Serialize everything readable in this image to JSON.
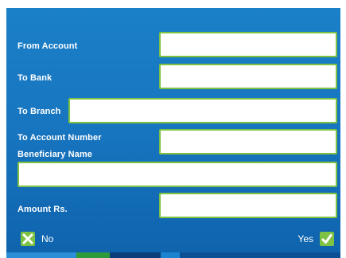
{
  "form": {
    "from_account": {
      "label": "From Account",
      "value": ""
    },
    "to_bank": {
      "label": "To Bank",
      "value": ""
    },
    "to_branch": {
      "label": "To Branch",
      "value": ""
    },
    "to_account_number": {
      "label": "To Account Number",
      "value": ""
    },
    "beneficiary_name": {
      "label": "Beneficiary Name",
      "value": ""
    },
    "amount": {
      "label": "Amount Rs.",
      "value": ""
    }
  },
  "actions": {
    "no_label": "No",
    "yes_label": "Yes"
  },
  "icons": {
    "no": "close-icon",
    "yes": "check-icon"
  },
  "colors": {
    "background": "#1876c0",
    "field_border": "#7dc242",
    "button_green": "#7dc242",
    "bottom_bar_green": "#2e9b3a",
    "bottom_bar_navy": "#0c3f7a",
    "bottom_bar_blue": "#1a84d0"
  }
}
